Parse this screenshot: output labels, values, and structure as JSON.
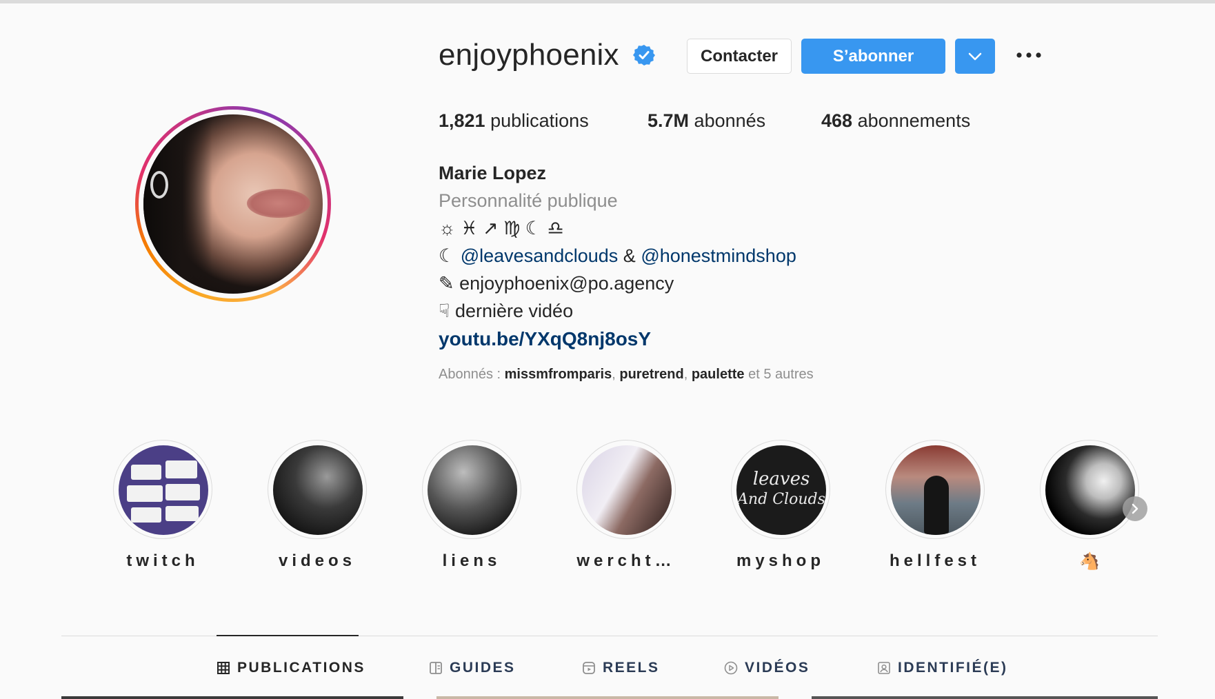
{
  "profile": {
    "username": "enjoyphoenix",
    "verified": true,
    "buttons": {
      "contact": "Contacter",
      "follow": "S’abonner"
    },
    "stats": {
      "posts_count": "1,821",
      "posts_label": "publications",
      "followers_count": "5.7M",
      "followers_label": "abonnés",
      "following_count": "468",
      "following_label": "abonnements"
    },
    "full_name": "Marie Lopez",
    "category": "Personnalité publique",
    "bio": {
      "zodiac_line": "☼ ♓ ↗ ♍ ☾ ♎",
      "moon_emoji": "☾",
      "mention_1": "@leavesandclouds",
      "and_text": " & ",
      "mention_2": "@honestmindshop",
      "pencil_emoji": "✎",
      "email": "enjoyphoenix@po.agency",
      "finger_emoji": "☟",
      "video_text": "dernière vidéo",
      "link": "youtu.be/YXqQ8nj8osY"
    },
    "followed_by": {
      "prefix": "Abonnés : ",
      "names": [
        "missmfromparis",
        "puretrend",
        "paulette"
      ],
      "suffix": "et 5 autres"
    }
  },
  "highlights": [
    {
      "label": "twitch"
    },
    {
      "label": "videos"
    },
    {
      "label": "liens"
    },
    {
      "label": "wercht…"
    },
    {
      "label": "myshop"
    },
    {
      "label": "hellfest"
    },
    {
      "label": "🐴"
    }
  ],
  "highlight_image_texts": {
    "myshop_line1": "leaves",
    "myshop_line2": "And Clouds"
  },
  "tabs": [
    {
      "label": "PUBLICATIONS",
      "icon": "grid-icon",
      "active": true
    },
    {
      "label": "GUIDES",
      "icon": "guide-icon",
      "active": false
    },
    {
      "label": "REELS",
      "icon": "reels-icon",
      "active": false
    },
    {
      "label": "VIDÉOS",
      "icon": "play-icon",
      "active": false
    },
    {
      "label": "IDENTIFIÉ(E)",
      "icon": "tagged-icon",
      "active": false
    }
  ],
  "colors": {
    "accent_blue": "#3897f0",
    "link_blue": "#00376b",
    "text": "#262626",
    "muted": "#8e8e8e",
    "background": "#fafafa"
  }
}
